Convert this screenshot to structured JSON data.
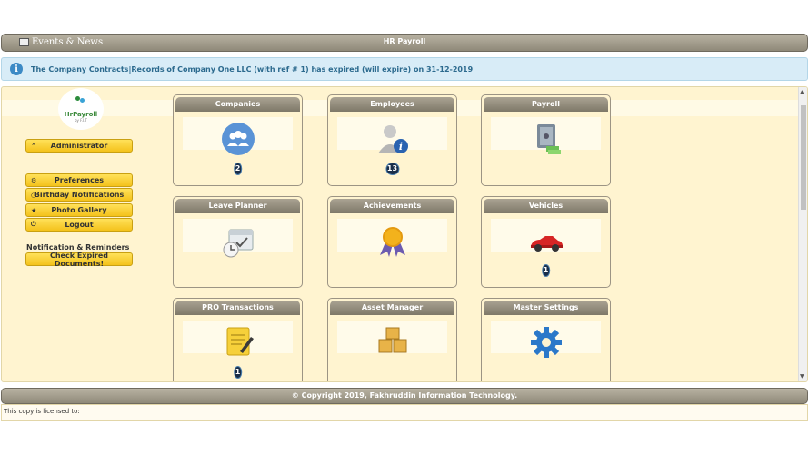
{
  "titlebar": {
    "events_tab": "Events & News",
    "title": "HR Payroll"
  },
  "alert": {
    "message": "The Company Contracts|Records of Company One LLC (with ref # 1) has expired (will expire) on 31-12-2019"
  },
  "sidebar": {
    "logo_name": "HrPayroll",
    "logo_by": "by F.I.T",
    "user_button": "Administrator",
    "menu": [
      {
        "label": "Preferences",
        "icon": "gear-icon"
      },
      {
        "label": "Birthday Notifications",
        "icon": "clock-icon"
      },
      {
        "label": "Photo Gallery",
        "icon": "star-icon"
      },
      {
        "label": "Logout",
        "icon": "power-icon"
      }
    ],
    "notif_label": "Notification & Reminders",
    "check_button": "Check Expired Documents!"
  },
  "tiles": [
    {
      "title": "Companies",
      "count": "2",
      "icon": "people-icon"
    },
    {
      "title": "Employees",
      "count": "13",
      "icon": "employee-info-icon"
    },
    {
      "title": "Payroll",
      "count": "",
      "icon": "safe-money-icon"
    },
    {
      "title": "Leave Planner",
      "count": "",
      "icon": "calendar-clock-icon"
    },
    {
      "title": "Achievements",
      "count": "",
      "icon": "award-ribbon-icon"
    },
    {
      "title": "Vehicles",
      "count": "1",
      "icon": "car-icon"
    },
    {
      "title": "PRO Transactions",
      "count": "1",
      "icon": "notepad-pen-icon"
    },
    {
      "title": "Asset Manager",
      "count": "",
      "icon": "boxes-icon"
    },
    {
      "title": "Master Settings",
      "count": "",
      "icon": "gear-icon"
    }
  ],
  "footer": {
    "copyright": "© Copyright 2019, Fakhruddin Information Technology.",
    "license": "This copy is licensed to:"
  },
  "colors": {
    "accent_yellow": "#f4c21c",
    "bar_gray": "#8f8979",
    "background": "#fff4d0",
    "alert_bg": "#d8ecf7"
  }
}
